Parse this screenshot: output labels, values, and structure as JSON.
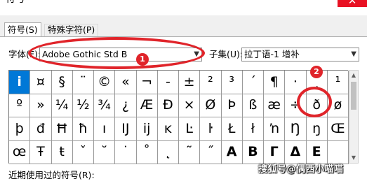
{
  "window": {
    "title": "符号",
    "close_glyph": "✕"
  },
  "tabs": [
    {
      "label": "符号(S)"
    },
    {
      "label": "特殊字符(P)"
    }
  ],
  "font": {
    "label": "字体(F):",
    "value": "Adobe Gothic Std B"
  },
  "subset": {
    "label": "子集(U):",
    "value": "拉丁语-1 增补"
  },
  "symbols": [
    "i",
    "¤",
    "§",
    "¨",
    "©",
    "«",
    "¬",
    "-",
    "±",
    "²",
    "³",
    "´",
    "¶",
    "·",
    "¸",
    "¹",
    "º",
    "»",
    "¼",
    "½",
    "¾",
    "¿",
    "Æ",
    "Đ",
    "×",
    "Ø",
    "Þ",
    "ß",
    "æ",
    "÷",
    "ð",
    "ø",
    "þ",
    "đ",
    "Ħ",
    "ħ",
    "ı",
    "Ĳ",
    "ĳ",
    "ĸ",
    "Ŀ",
    "ŀ",
    "Ł",
    "ł",
    "ŉ",
    "Ŋ",
    "ŋ",
    "Œ",
    "œ",
    "Ŧ",
    "ŧ",
    "ˇ",
    "˘",
    "˙",
    "˚",
    "˛",
    "˜",
    "˝",
    "Α",
    "Β",
    "Γ",
    "Δ",
    "Ε",
    ""
  ],
  "recent_label": "近期使用过的符号(R):",
  "annotations": {
    "badge_1": "1",
    "badge_2": "2"
  },
  "watermark": "搜狐号@偶西小喵喵",
  "colors": {
    "selection": "#0078d7",
    "annotation": "#e0242a",
    "close": "#e81123"
  }
}
